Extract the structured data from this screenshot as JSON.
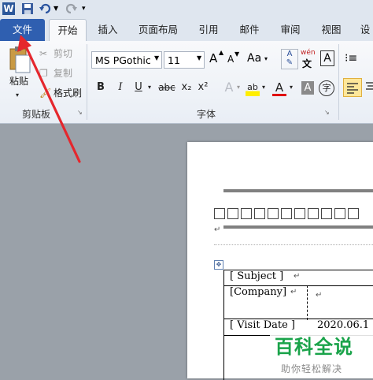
{
  "tabs": {
    "file": "文件",
    "home": "开始",
    "insert": "插入",
    "layout": "页面布局",
    "references": "引用",
    "mailings": "邮件",
    "review": "审阅",
    "view": "视图",
    "more": "设"
  },
  "clipboard": {
    "paste": "粘贴",
    "cut": "剪切",
    "copy": "复制",
    "format_painter": "格式刷",
    "group_label": "剪贴板"
  },
  "font": {
    "name": "MS PGothic",
    "size": "11",
    "group_label": "字体",
    "grow": "A",
    "shrink": "A",
    "change_case": "Aa",
    "phonetic_top": "wén",
    "bold": "B",
    "italic": "I",
    "underline": "U",
    "strikethrough": "abc",
    "subscript": "x₂",
    "superscript": "x²",
    "highlight": "ab",
    "font_color": "A",
    "char_shading": "A",
    "enclose": "字"
  },
  "document": {
    "subject": "[ Subject ]",
    "company": "[Company]",
    "visit_date_label": "[ Visit Date ]",
    "visit_date_value": "2020.06.1",
    "return_mark": "↵",
    "boxes_count_label": "□□□□□□□□□□□"
  },
  "watermark": {
    "title": "百科全说",
    "subtitle": "助你轻松解决"
  },
  "colors": {
    "file_tab": "#2f5fb0",
    "arrow": "#e5272d",
    "watermark_green": "#1aa34a"
  }
}
